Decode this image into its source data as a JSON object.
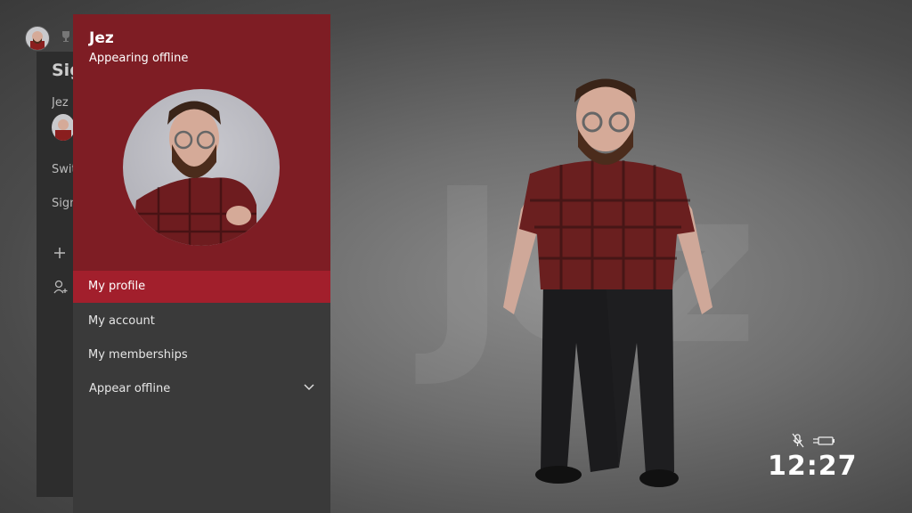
{
  "background": {
    "watermark_text": "Jez"
  },
  "back_panel": {
    "title": "Sig",
    "user": "Jez",
    "item_switch": "Swit",
    "item_sign": "Sign"
  },
  "account_panel": {
    "name": "Jez",
    "status": "Appearing offline",
    "accent_color": "#7e1d24",
    "selected_color": "#a21f2c",
    "menu": [
      {
        "label": "My profile",
        "selected": true
      },
      {
        "label": "My account"
      },
      {
        "label": "My memberships"
      },
      {
        "label": "Appear offline",
        "icon": "chevron-down-icon"
      }
    ]
  },
  "status_bar": {
    "icons": [
      "mic-muted-icon",
      "power-plug-icon"
    ],
    "time": "12:27"
  }
}
